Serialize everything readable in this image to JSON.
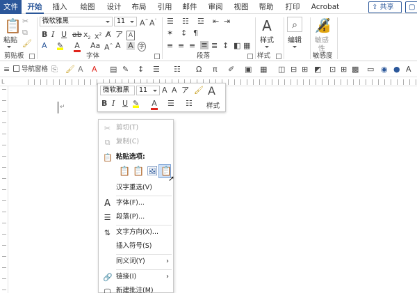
{
  "tabs": [
    "文件",
    "开始",
    "插入",
    "绘图",
    "设计",
    "布局",
    "引用",
    "邮件",
    "审阅",
    "视图",
    "帮助",
    "打印",
    "Acrobat"
  ],
  "active_tab": "开始",
  "share_label": "共享",
  "comment_label": "批",
  "ribbon": {
    "clipboard": {
      "paste_label": "粘贴",
      "group_label": "剪贴板"
    },
    "font": {
      "font_name": "微软雅黑",
      "font_size": "11",
      "size_unit": "A",
      "group_label": "字体"
    },
    "paragraph": {
      "group_label": "段落"
    },
    "styles": {
      "button_label": "样式",
      "group_label": "样式"
    },
    "editing": {
      "button_label": "编辑"
    },
    "sensitivity": {
      "button_label_1": "敏感",
      "button_label_2": "性",
      "group_label": "敏感度"
    }
  },
  "qat": {
    "nav_pane_label": "导航窗格"
  },
  "mini_toolbar": {
    "font_name": "微软雅黑",
    "font_size": "11",
    "styles_label": "样式"
  },
  "context_menu": {
    "items": [
      {
        "label": "剪切(T)",
        "icon": "cut-icon",
        "disabled": true
      },
      {
        "label": "复制(C)",
        "icon": "copy-icon",
        "disabled": true
      },
      {
        "label": "粘贴选项:",
        "icon": "paste-icon",
        "disabled": false
      },
      {
        "label": "汉字重选(V)",
        "icon": "",
        "disabled": false
      },
      {
        "label": "字体(F)...",
        "icon": "font-icon",
        "disabled": false
      },
      {
        "label": "段落(P)...",
        "icon": "paragraph-icon",
        "disabled": false
      },
      {
        "label": "文字方向(X)...",
        "icon": "text-direction-icon",
        "disabled": false
      },
      {
        "label": "插入符号(S)",
        "icon": "",
        "disabled": false
      },
      {
        "label": "同义词(Y)",
        "icon": "",
        "disabled": false
      },
      {
        "label": "链接(I)",
        "icon": "link-icon",
        "disabled": false
      },
      {
        "label": "新建批注(M)",
        "icon": "new-comment-icon",
        "disabled": false
      }
    ],
    "paste_options": [
      "keep-source-formatting-icon",
      "merge-formatting-icon",
      "picture-icon",
      "keep-text-only-icon"
    ]
  },
  "colors": {
    "accent": "#2b579a",
    "highlight": "#ffff00",
    "font_color": "#e0241b",
    "selection": "#cde0f7"
  }
}
